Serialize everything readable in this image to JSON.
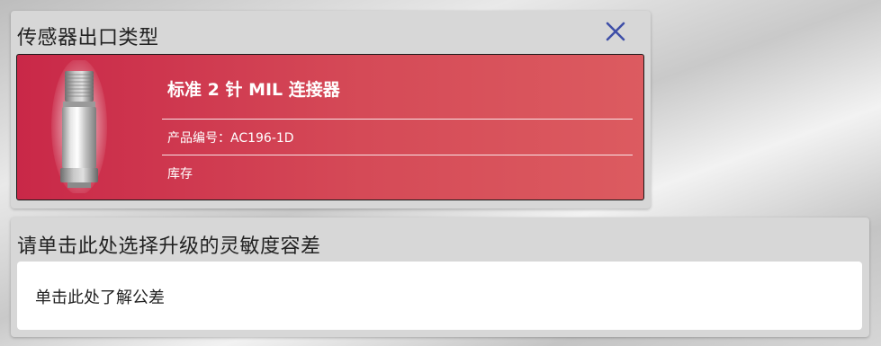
{
  "sensor_panel": {
    "title": "传感器出口类型",
    "close_icon": "close-icon",
    "close_color": "#3f4fa8",
    "product": {
      "name": "标准 2 针 MIL 连接器",
      "part_number": "产品编号：AC196-1D",
      "stock": "库存",
      "image_icon": "sensor-connector-image",
      "card_color_start": "#c92848",
      "card_color_end": "#dc5b60"
    }
  },
  "tolerance_panel": {
    "title": "请单击此处选择升级的灵敏度容差",
    "link_text": "单击此处了解公差"
  }
}
